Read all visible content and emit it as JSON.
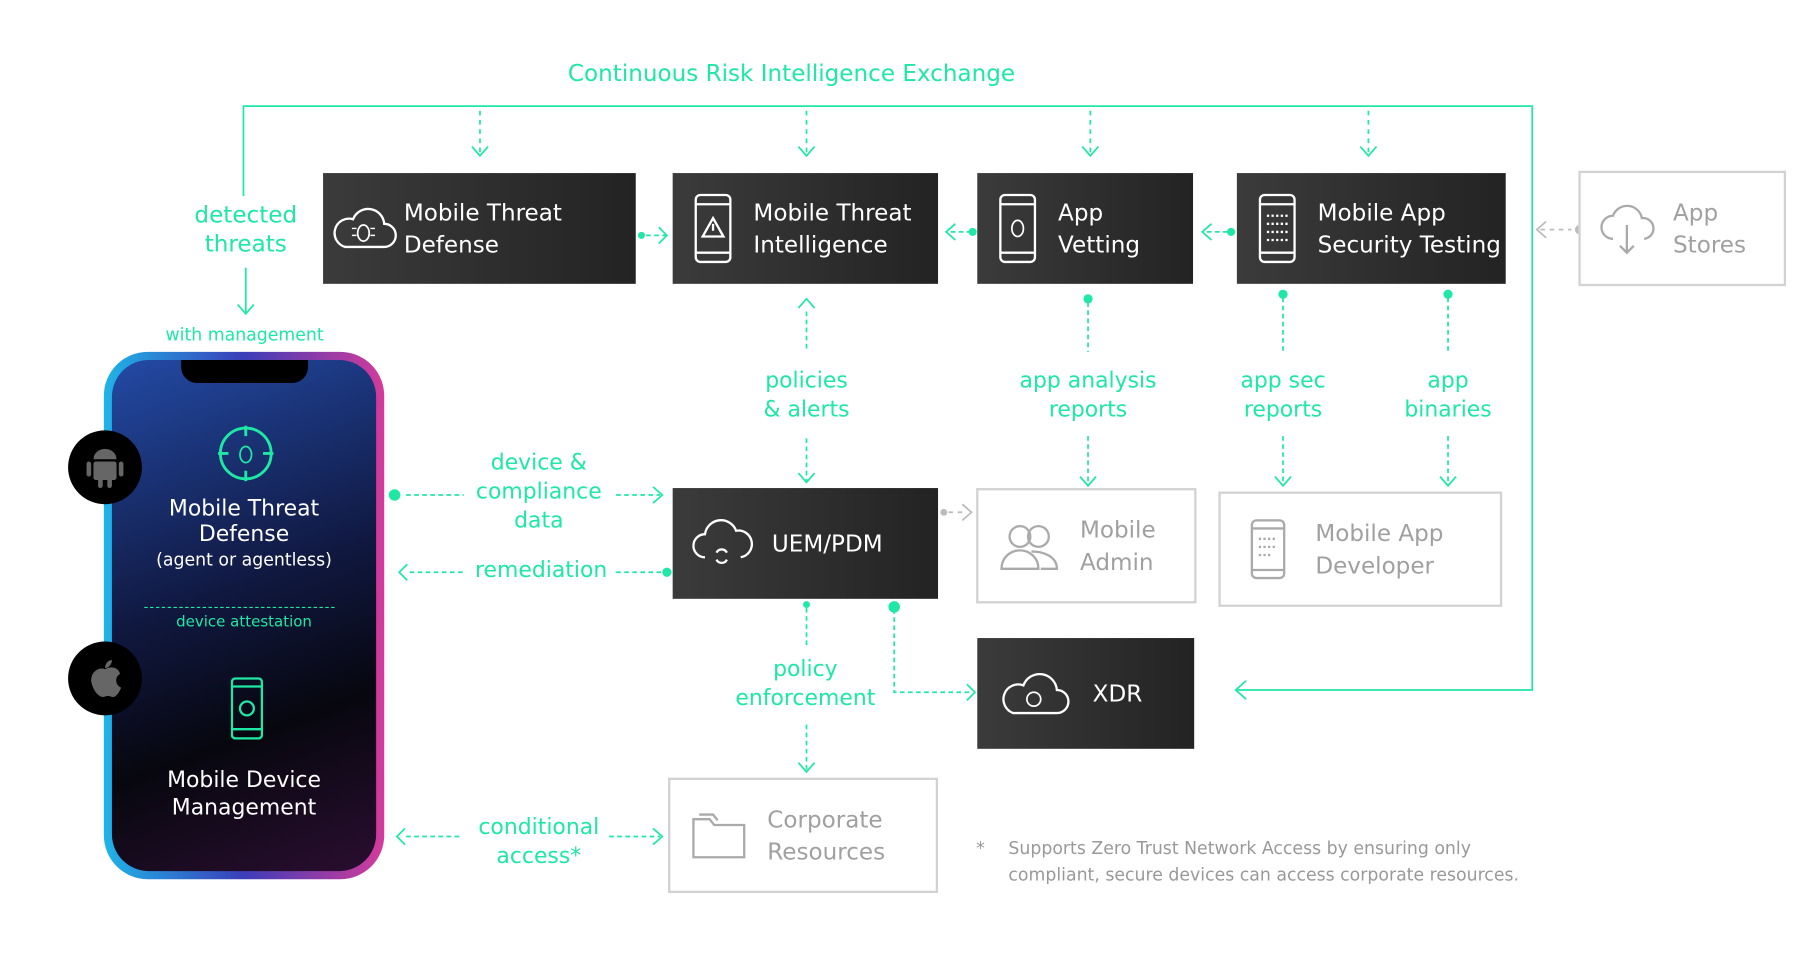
{
  "title": "Continuous Risk Intelligence Exchange",
  "accent_color": "#1ee8a4",
  "phone": {
    "mtd_title_1": "Mobile Threat",
    "mtd_title_2": "Defense",
    "mtd_subtitle": "(agent or agentless)",
    "attestation": "device attestation",
    "mdm_title_1": "Mobile Device",
    "mdm_title_2": "Management",
    "os_icons": [
      "android-icon",
      "apple-icon"
    ]
  },
  "boxes": {
    "mtd": {
      "line1": "Mobile Threat",
      "line2": "Defense",
      "icon": "cloud-bug-icon"
    },
    "mti": {
      "line1": "Mobile Threat",
      "line2": "Intelligence",
      "icon": "phone-warning-icon"
    },
    "vetting": {
      "line1": "App",
      "line2": "Vetting",
      "icon": "phone-bug-icon"
    },
    "mast": {
      "line1": "Mobile App",
      "line2": "Security Testing",
      "icon": "phone-binary-icon"
    },
    "stores": {
      "line1": "App",
      "line2": "Stores",
      "icon": "cloud-download-icon"
    },
    "uem": {
      "line1": "UEM/PDM",
      "icon": "cloud-sync-icon"
    },
    "admin": {
      "line1": "Mobile",
      "line2": "Admin",
      "icon": "users-icon"
    },
    "developer": {
      "line1": "Mobile App",
      "line2": "Developer",
      "icon": "phone-binary-icon"
    },
    "xdr": {
      "line1": "XDR",
      "icon": "cloud-binary-icon"
    },
    "corporate": {
      "line1": "Corporate",
      "line2": "Resources",
      "icon": "folder-icon"
    }
  },
  "labels": {
    "detected_1": "detected",
    "detected_2": "threats",
    "with_management": "with management",
    "policies_1": "policies",
    "policies_2": "& alerts",
    "analysis_1": "app analysis",
    "analysis_2": "reports",
    "appsec_1": "app sec",
    "appsec_2": "reports",
    "binaries_1": "app",
    "binaries_2": "binaries",
    "compliance_1": "device &",
    "compliance_2": "compliance",
    "compliance_3": "data",
    "remediation": "remediation",
    "policy_1": "policy",
    "policy_2": "enforcement",
    "conditional_1": "conditional",
    "conditional_2": "access*"
  },
  "footnote": {
    "mark": "*",
    "line1": "Supports Zero Trust Network Access by ensuring only",
    "line2": "compliant, secure devices can access corporate resources."
  }
}
